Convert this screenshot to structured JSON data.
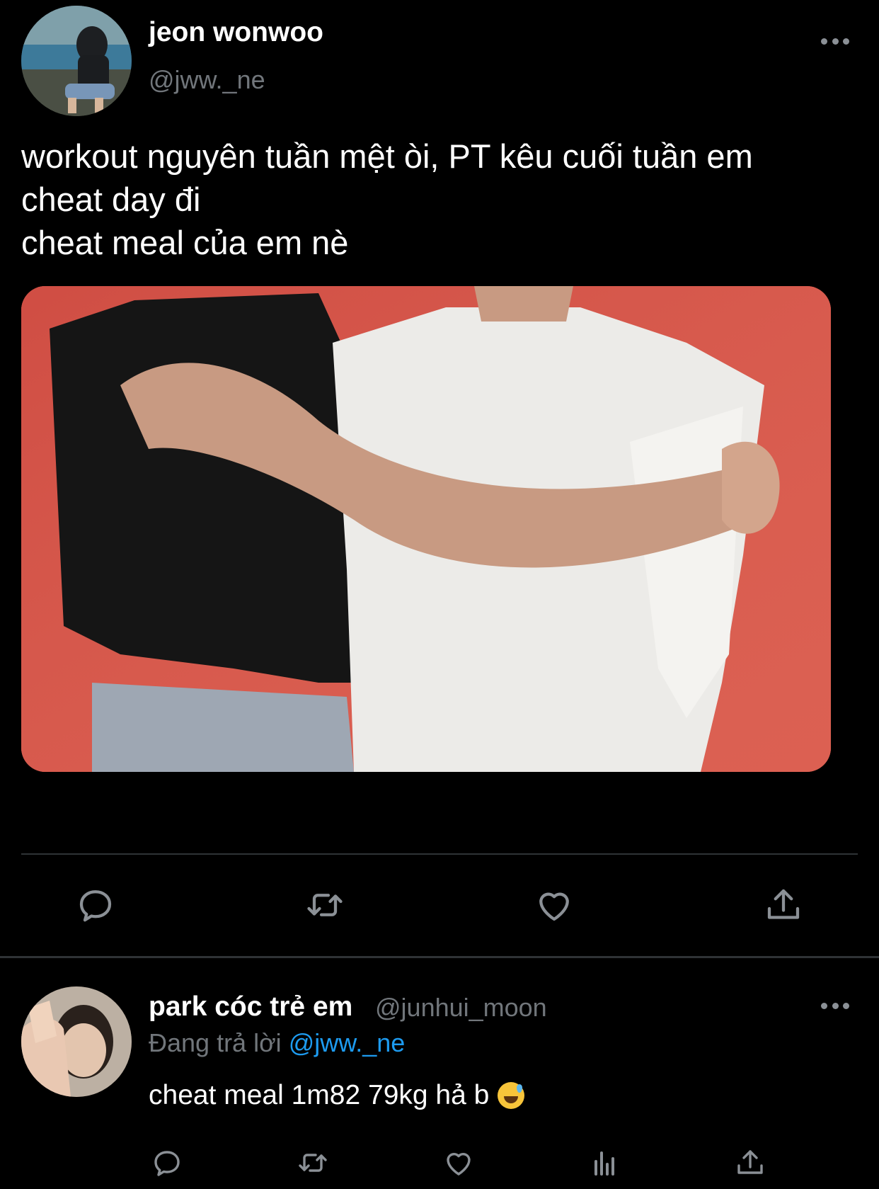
{
  "main_tweet": {
    "author_name": "jeon wonwoo",
    "handle": "@jww._ne",
    "text": "workout nguyên tuần mệt òi, PT kêu cuối tuần em\ncheat day đi\ncheat meal của em nè",
    "actions": [
      "reply-icon",
      "retweet-icon",
      "like-icon",
      "share-icon"
    ]
  },
  "reply": {
    "author_name": "park cóc trẻ em",
    "handle": "@junhui_moon",
    "context_prefix": "Đang trả lời",
    "context_mention": "@jww._ne",
    "text": "cheat meal 1m82 79kg hả b",
    "actions": [
      "reply-icon",
      "retweet-icon",
      "like-icon",
      "views-icon",
      "share-icon"
    ]
  },
  "colors": {
    "background": "#000000",
    "secondary_text": "#71767b",
    "link": "#1d9bf0",
    "divider": "#2f3336"
  }
}
